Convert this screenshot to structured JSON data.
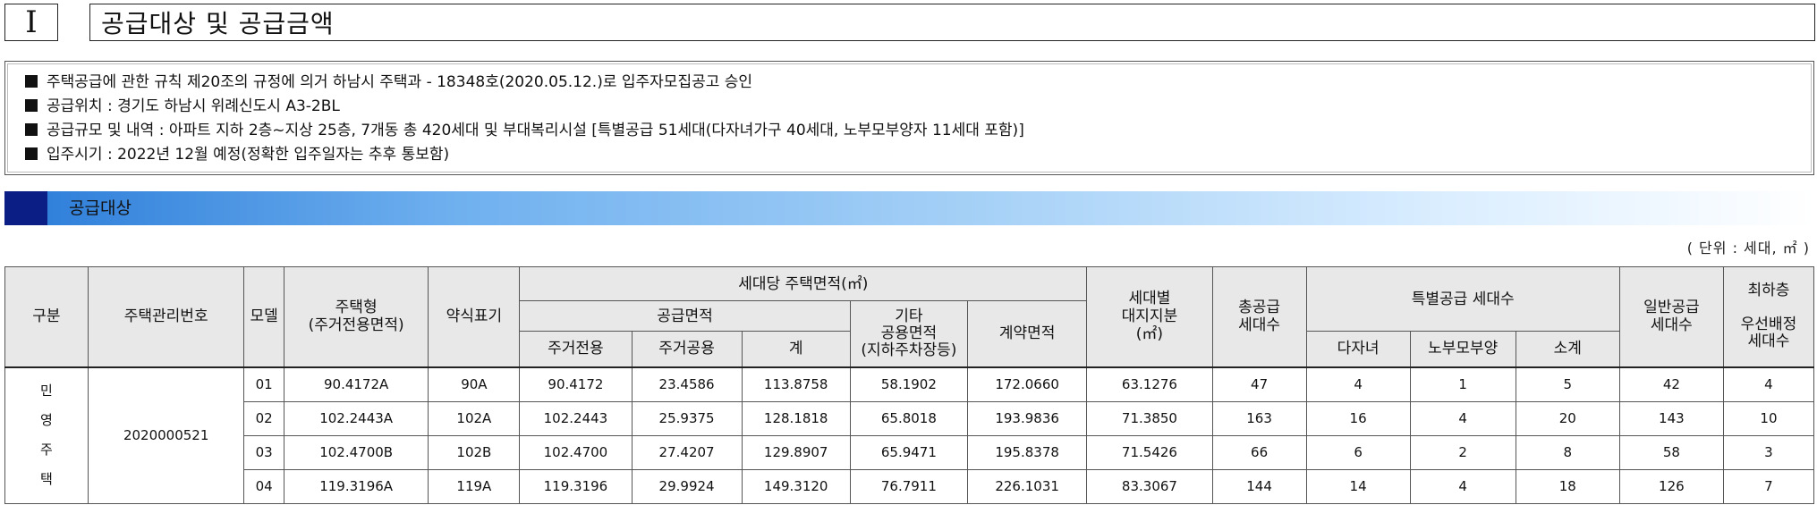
{
  "header": {
    "section_number": "Ⅰ",
    "title": "공급대상 및 공급금액"
  },
  "notice": {
    "items": [
      "주택공급에 관한 규칙 제20조의 규정에 의거 하남시 주택과 - 18348호(2020.05.12.)로 입주자모집공고 승인",
      "공급위치 : 경기도 하남시 위례신도시 A3-2BL",
      "공급규모 및 내역 : 아파트 지하 2층~지상 25층, 7개동 총 420세대 및 부대복리시설 [특별공급 51세대(다자녀가구 40세대, 노부모부양자 11세대 포함)]",
      "입주시기 : 2022년 12월 예정(정확한 입주일자는 추후 통보함)"
    ]
  },
  "section": {
    "title": "공급대상"
  },
  "unit_note": "( 단위 : 세대, ㎡ )",
  "table": {
    "headers": {
      "category": "구분",
      "mgmt_no": "주택관리번호",
      "model": "모델",
      "house_type": "주택형\n(주거전용면적)",
      "abbrev": "약식표기",
      "area_group": "세대당 주택면적(㎡)",
      "supply_area": "공급면적",
      "exclusive": "주거전용",
      "common": "주거공용",
      "subtotal": "계",
      "other_common": "기타\n공용면적\n(지하주차장등)",
      "contract_area": "계약면적",
      "land_share": "세대별\n대지지분\n(㎡)",
      "total_supply": "총공급\n세대수",
      "special_group": "특별공급 세대수",
      "multi_child": "다자녀",
      "elderly": "노부모부양",
      "special_sum": "소계",
      "general": "일반공급\n세대수",
      "lowest": "최하층\n\n우선배정\n세대수"
    },
    "category_label": "민\n영\n주\n택",
    "mgmt_no_value": "2020000521",
    "rows": [
      {
        "model": "01",
        "type": "90.4172A",
        "abbrev": "90A",
        "exclusive": "90.4172",
        "common": "23.4586",
        "subtotal": "113.8758",
        "other": "58.1902",
        "contract": "172.0660",
        "land": "63.1276",
        "total": "47",
        "multi": "4",
        "elderly": "1",
        "sum": "5",
        "general": "42",
        "lowest": "4"
      },
      {
        "model": "02",
        "type": "102.2443A",
        "abbrev": "102A",
        "exclusive": "102.2443",
        "common": "25.9375",
        "subtotal": "128.1818",
        "other": "65.8018",
        "contract": "193.9836",
        "land": "71.3850",
        "total": "163",
        "multi": "16",
        "elderly": "4",
        "sum": "20",
        "general": "143",
        "lowest": "10"
      },
      {
        "model": "03",
        "type": "102.4700B",
        "abbrev": "102B",
        "exclusive": "102.4700",
        "common": "27.4207",
        "subtotal": "129.8907",
        "other": "65.9471",
        "contract": "195.8378",
        "land": "71.5426",
        "total": "66",
        "multi": "6",
        "elderly": "2",
        "sum": "8",
        "general": "58",
        "lowest": "3"
      },
      {
        "model": "04",
        "type": "119.3196A",
        "abbrev": "119A",
        "exclusive": "119.3196",
        "common": "29.9924",
        "subtotal": "149.3120",
        "other": "76.7911",
        "contract": "226.1031",
        "land": "83.3067",
        "total": "144",
        "multi": "14",
        "elderly": "4",
        "sum": "18",
        "general": "126",
        "lowest": "7"
      }
    ]
  }
}
